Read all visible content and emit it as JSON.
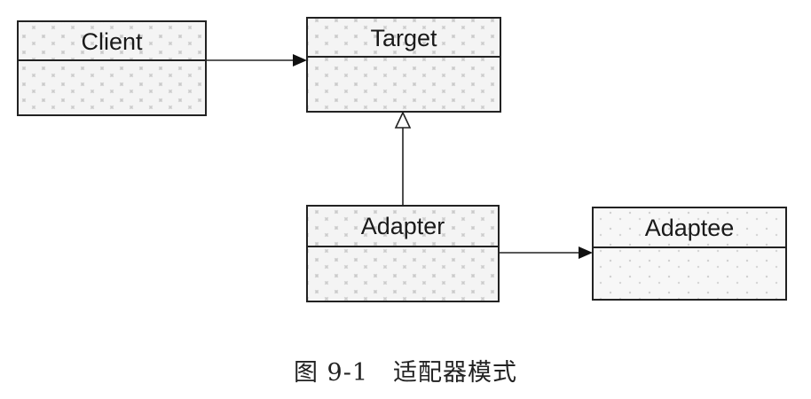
{
  "diagram": {
    "classes": {
      "client": "Client",
      "target": "Target",
      "adapter": "Adapter",
      "adaptee": "Adaptee"
    }
  },
  "caption": {
    "figure_number": "图 9-1",
    "title": "适配器模式"
  }
}
